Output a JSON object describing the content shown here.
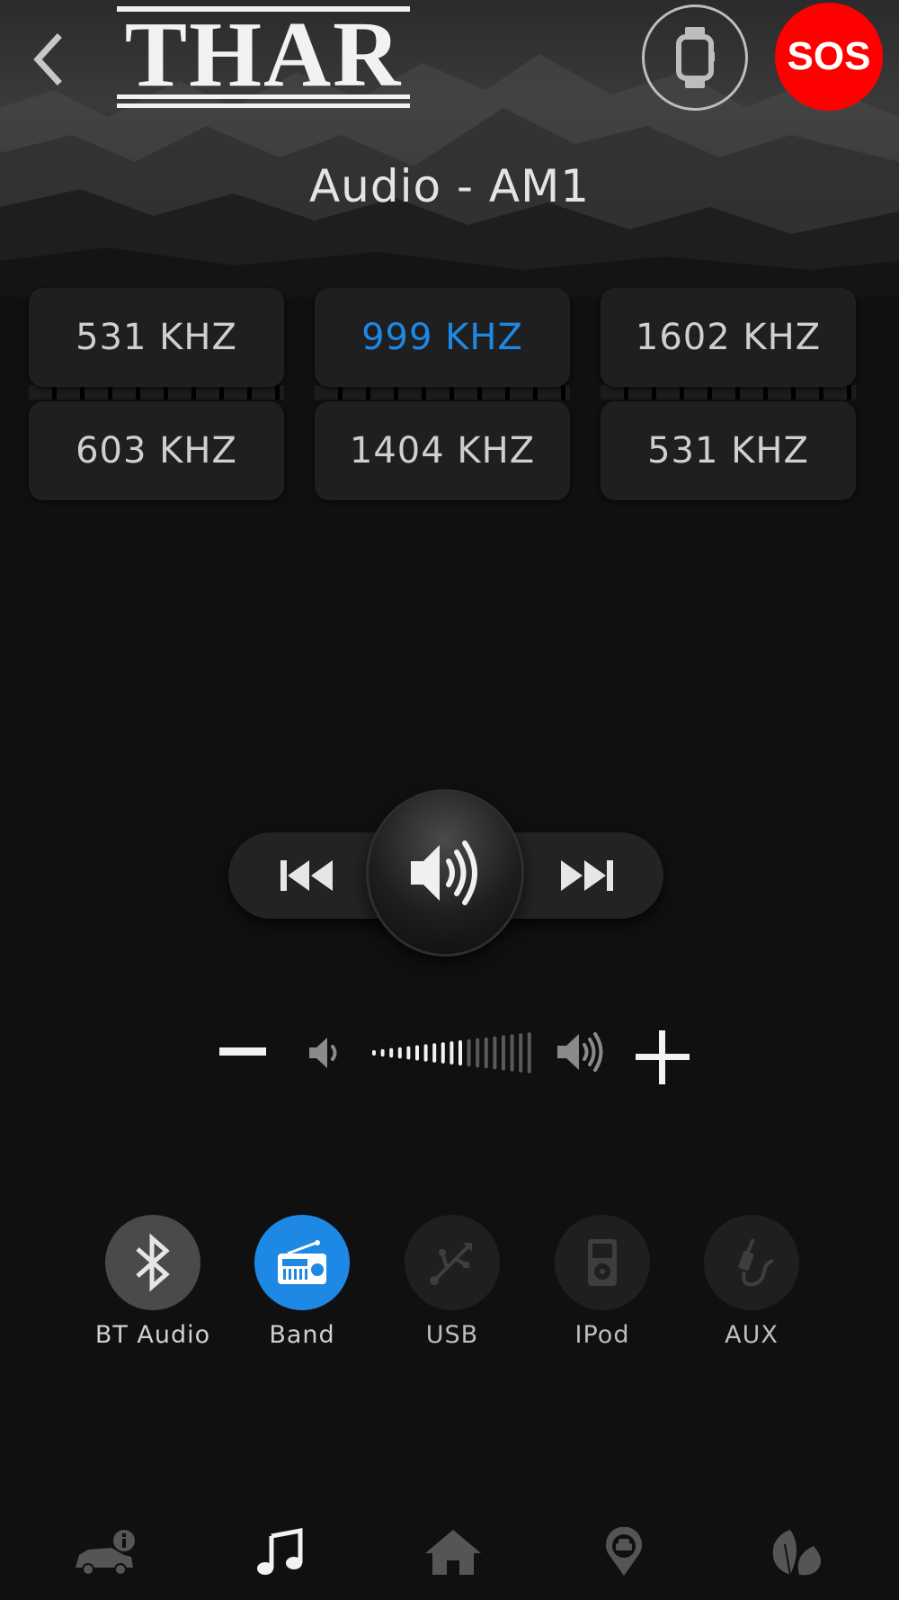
{
  "header": {
    "logo_text": "THAR",
    "sos_label": "SOS",
    "title": "Audio - AM1"
  },
  "presets": [
    {
      "label": "531 KHZ",
      "active": false
    },
    {
      "label": "999 KHZ",
      "active": true
    },
    {
      "label": "1602 KHZ",
      "active": false
    },
    {
      "label": "603 KHZ",
      "active": false
    },
    {
      "label": "1404 KHZ",
      "active": false
    },
    {
      "label": "531 KHZ",
      "active": false
    }
  ],
  "volume": {
    "level": 0.6
  },
  "sources": [
    {
      "label": "BT  Audio",
      "icon": "bluetooth-icon",
      "state": "available"
    },
    {
      "label": "Band",
      "icon": "radio-icon",
      "state": "selected"
    },
    {
      "label": "USB",
      "icon": "usb-icon",
      "state": "disabled"
    },
    {
      "label": "IPod",
      "icon": "ipod-icon",
      "state": "disabled"
    },
    {
      "label": "AUX",
      "icon": "aux-cable-icon",
      "state": "disabled"
    }
  ],
  "bottom_nav": [
    {
      "icon": "vehicle-info-icon",
      "active": false
    },
    {
      "icon": "music-note-icon",
      "active": true
    },
    {
      "icon": "home-icon",
      "active": false
    },
    {
      "icon": "car-location-pin-icon",
      "active": false
    },
    {
      "icon": "eco-leaf-icon",
      "active": false
    }
  ],
  "colors": {
    "accent": "#1e88e5",
    "sos": "#ff0000",
    "background": "#101010"
  }
}
